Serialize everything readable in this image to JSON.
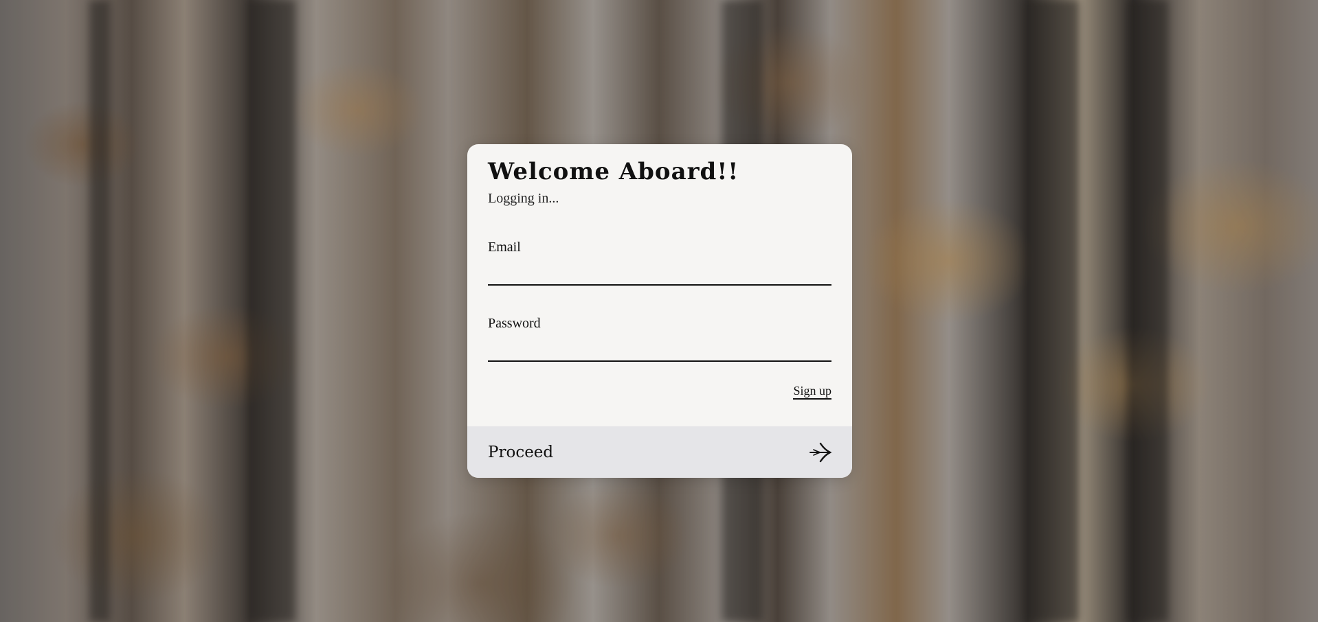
{
  "login": {
    "title": "Welcome Aboard!!",
    "subtitle": "Logging in...",
    "email_label": "Email",
    "email_value": "",
    "password_label": "Password",
    "password_value": "",
    "signup_label": "Sign up",
    "proceed_label": "Proceed",
    "proceed_icon": "arrow-right-icon"
  },
  "colors": {
    "card_background": "#f6f5f3",
    "proceed_background": "#e5e5e8",
    "text": "#111111"
  }
}
